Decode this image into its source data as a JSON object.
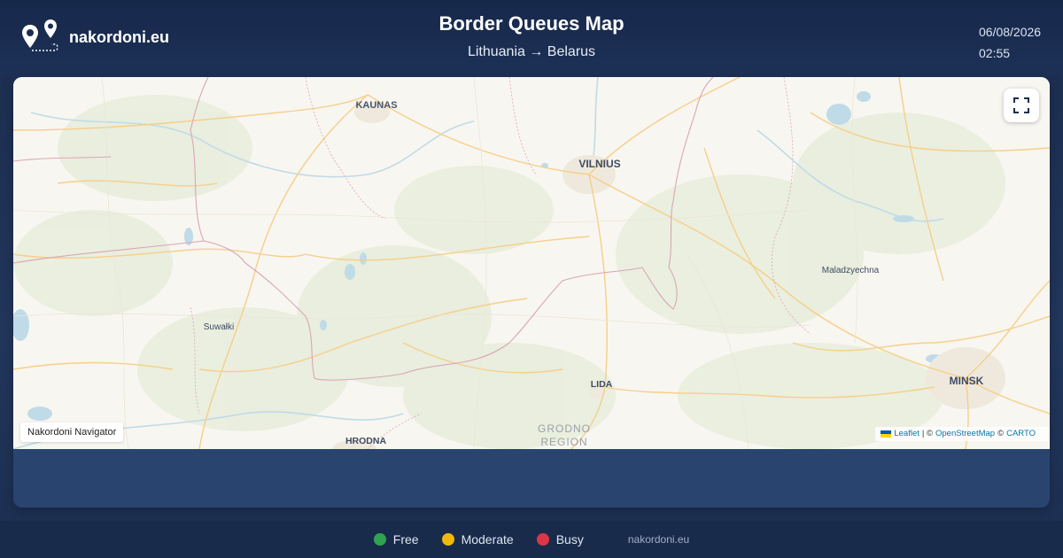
{
  "header": {
    "brand": "nakordoni.eu",
    "title": "Border Queues Map",
    "route": "Lithuania → Belarus",
    "date": "06/08/2026",
    "time": "02:55"
  },
  "map": {
    "labels": {
      "kaunas": "KAUNAS",
      "vilnius": "VILNIUS",
      "maladzyechna": "Maladzyechna",
      "suwalki": "Suwałki",
      "lida": "LIDA",
      "minsk": "MINSK",
      "hrodna": "HRODNA",
      "grodno_region_1": "GRODNO",
      "grodno_region_2": "REGION"
    },
    "badge": "Nakordoni Navigator",
    "attribution": {
      "leaflet": "Leaflet",
      "sep1": "| ©",
      "osm": "OpenStreetMap",
      "sep2": "©",
      "carto": "CARTO"
    }
  },
  "legend": [
    {
      "label": "Free",
      "color": "#2ea44f"
    },
    {
      "label": "Moderate",
      "color": "#f0b90b"
    },
    {
      "label": "Busy",
      "color": "#dc3545"
    }
  ],
  "footer": {
    "site": "nakordoni.eu"
  }
}
